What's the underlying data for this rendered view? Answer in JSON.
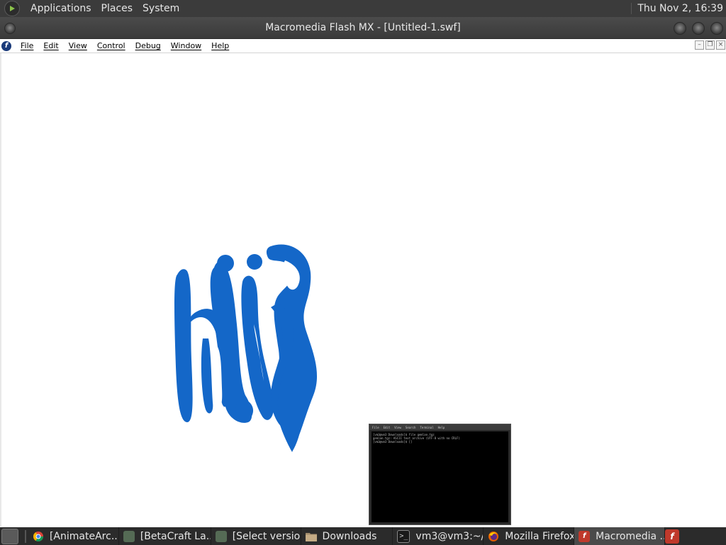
{
  "top_panel": {
    "menus": [
      "Applications",
      "Places",
      "System"
    ],
    "clock": "Thu Nov  2, 16:39"
  },
  "window": {
    "title": "Macromedia Flash MX - [Untitled-1.swf]"
  },
  "menubar": {
    "items": [
      "File",
      "Edit",
      "View",
      "Control",
      "Debug",
      "Window",
      "Help"
    ]
  },
  "stage": {
    "artwork_color": "#1467c8"
  },
  "thumbnail": {
    "menu": [
      "File",
      "Edit",
      "View",
      "Search",
      "Terminal",
      "Help"
    ],
    "lines": [
      "[vm3@vm3 Downloads]$ file gemlan.tgz",
      "gemlan.tgz: ASCII text archive (UTF-8 with no CRLF)",
      "[vm3@vm3 Downloads]$ []"
    ]
  },
  "taskbar": {
    "tasks": [
      {
        "label": "[AnimateArc...",
        "icon": "chrome-icon"
      },
      {
        "label": "[BetaCraft La...",
        "icon": "app-icon"
      },
      {
        "label": "[Select version]",
        "icon": "app-icon"
      },
      {
        "label": "Downloads",
        "icon": "folder-icon"
      },
      {
        "label": "vm3@vm3:~/...",
        "icon": "terminal-icon"
      },
      {
        "label": "Mozilla Firefox",
        "icon": "firefox-icon"
      },
      {
        "label": "Macromedia ...",
        "icon": "flash-icon"
      }
    ]
  }
}
